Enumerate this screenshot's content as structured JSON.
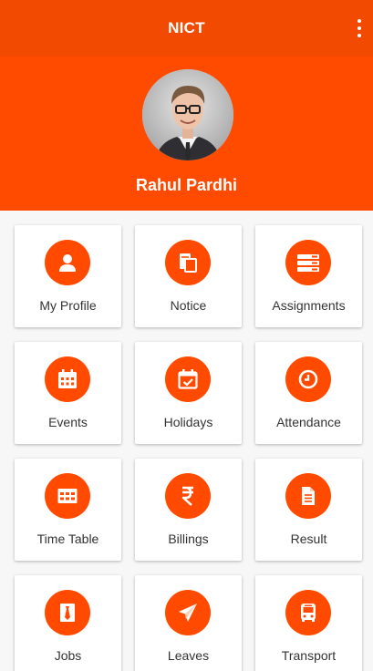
{
  "appbar": {
    "title": "NICT",
    "menu_icon": "more-vert-icon"
  },
  "profile": {
    "name": "Rahul Pardhi"
  },
  "colors": {
    "primary": "#f24a00",
    "accent": "#ff4b00",
    "icon_circle": "#ff4a00"
  },
  "tiles": [
    {
      "label": "My Profile",
      "icon": "person-icon"
    },
    {
      "label": "Notice",
      "icon": "notice-icon"
    },
    {
      "label": "Assignments",
      "icon": "assignments-icon"
    },
    {
      "label": "Events",
      "icon": "calendar-grid-icon"
    },
    {
      "label": "Holidays",
      "icon": "calendar-check-icon"
    },
    {
      "label": "Attendance",
      "icon": "clock-icon"
    },
    {
      "label": "Time Table",
      "icon": "table-icon"
    },
    {
      "label": "Billings",
      "icon": "rupee-icon"
    },
    {
      "label": "Result",
      "icon": "document-icon"
    },
    {
      "label": "Jobs",
      "icon": "tie-icon"
    },
    {
      "label": "Leaves",
      "icon": "paper-plane-icon"
    },
    {
      "label": "Transport",
      "icon": "bus-icon"
    }
  ]
}
